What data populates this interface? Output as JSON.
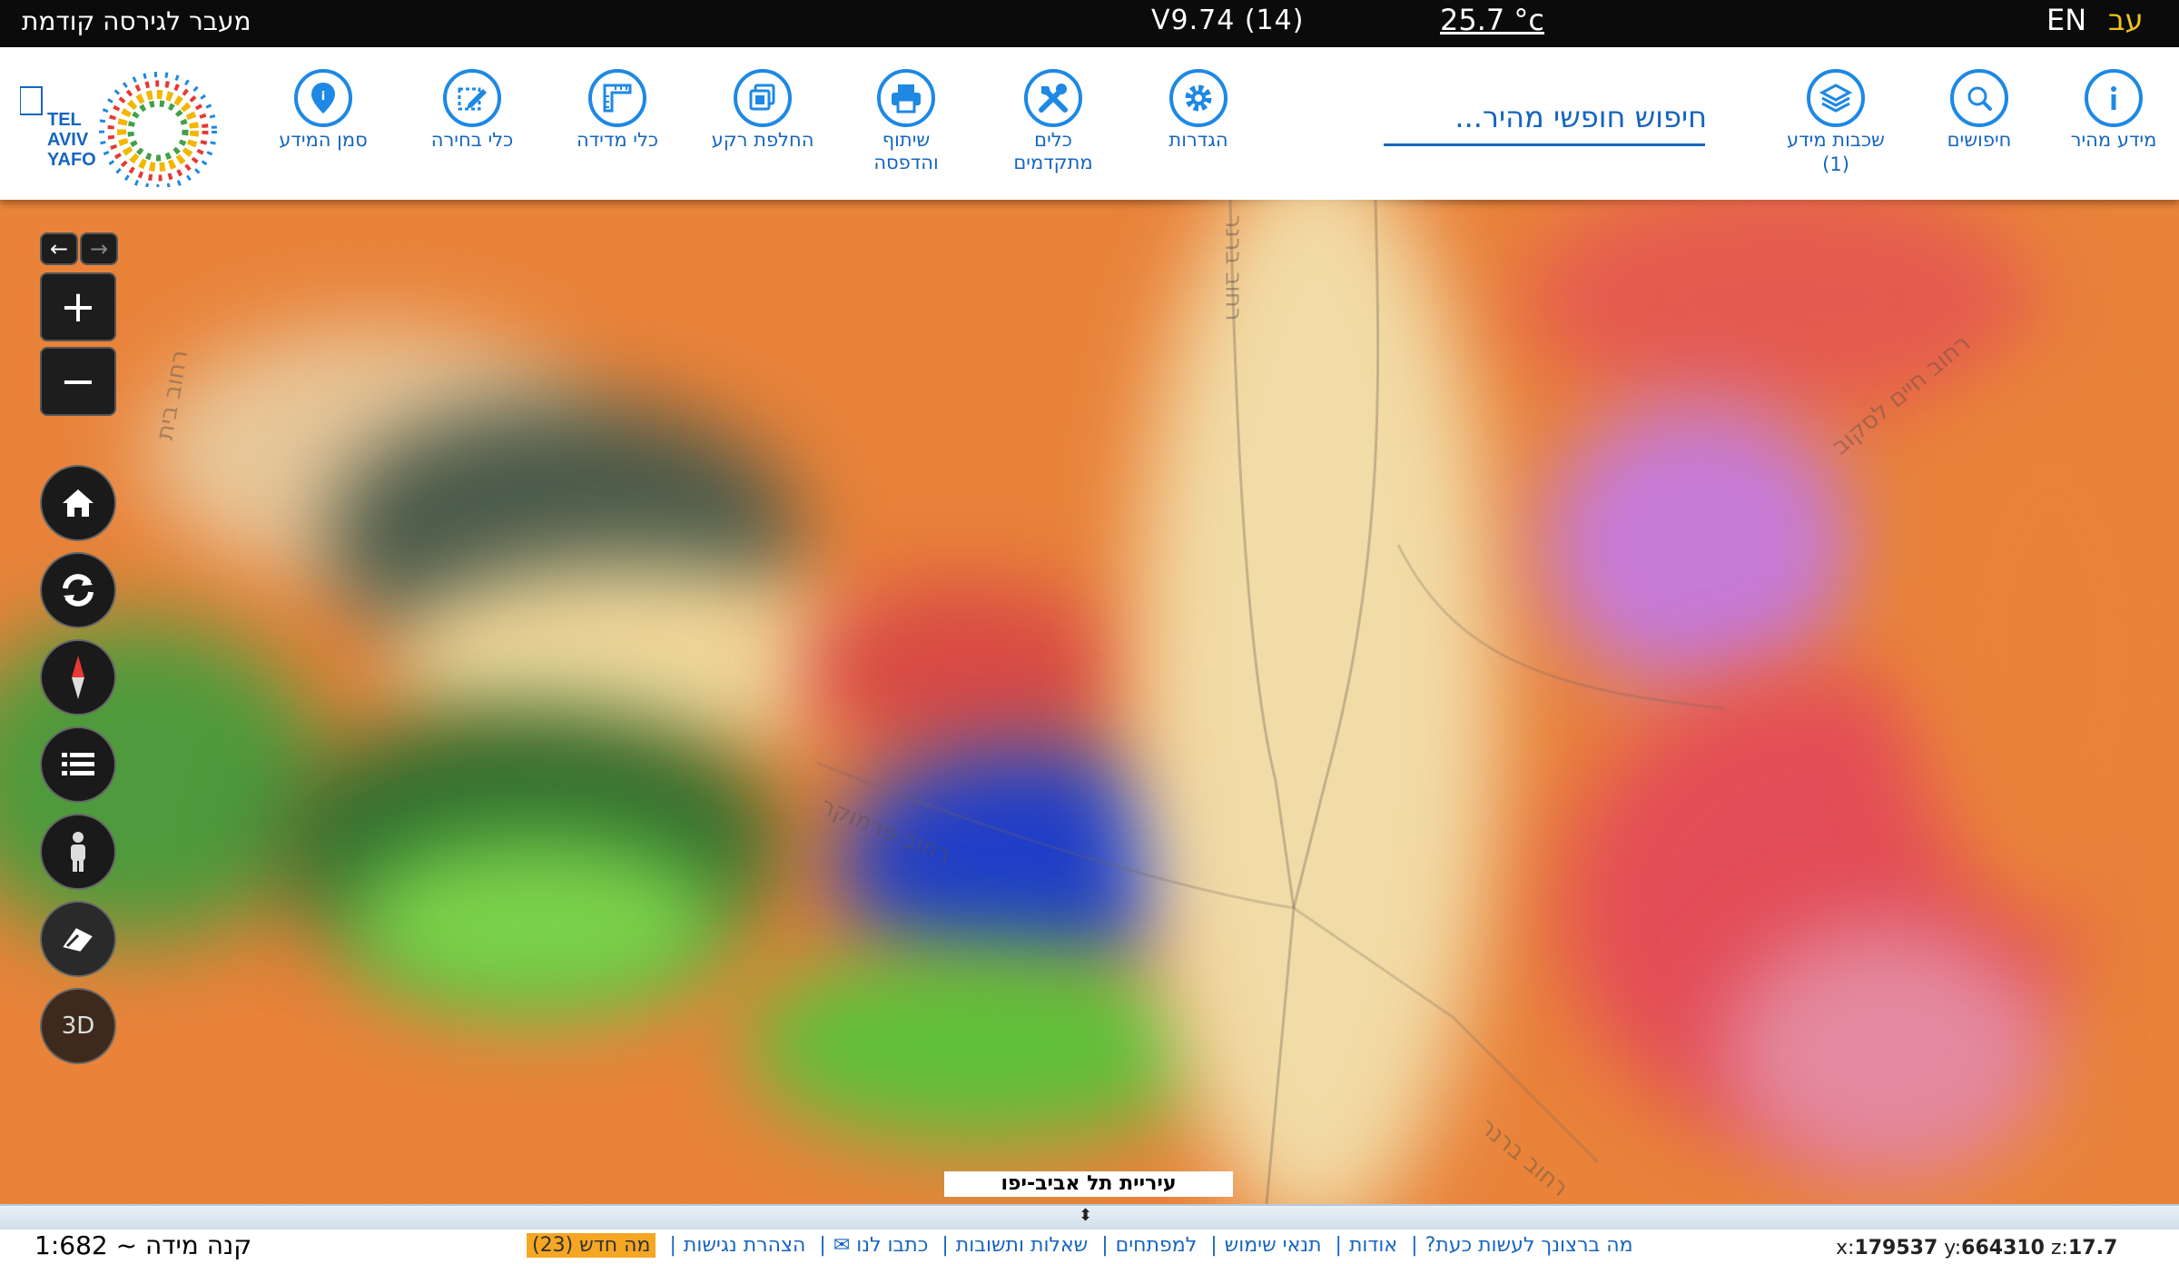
{
  "topbar": {
    "prev_version": "מעבר לגירסה קודמת",
    "version": "V9.74 (14)",
    "temperature": "25.7 °c",
    "lang_en": "EN",
    "lang_he": "עב"
  },
  "toolbar": {
    "quick_info": "מידע מהיר",
    "searches": "חיפושים",
    "layers": "שכבות מידע",
    "layers_count": "(1)",
    "search_placeholder": "חיפוש חופשי מהיר...",
    "settings": "הגדרות",
    "advanced_tools": "כלים מתקדמים",
    "share_print": "שיתוף והדפסה",
    "basemap": "החלפת רקע",
    "measure": "כלי מדידה",
    "select": "כלי בחירה",
    "marker": "סמן המידע",
    "logo_text": "TEL AVIV YAFO"
  },
  "map": {
    "municipality": "עיריית תל אביב-יפו",
    "street_labels": [
      "רחוב ברנר",
      "רחוב פרמוקר",
      "רחוב חיים לסקוב",
      "רחוב ברנר",
      "רחוב בית"
    ],
    "controls": {
      "zoom_in": "+",
      "zoom_out": "−",
      "threeD": "3D"
    }
  },
  "bottom": {
    "scale": "קנה מידה ~ 1:682",
    "links": [
      "מה ברצונך לעשות כעת?",
      "אודות",
      "תנאי שימוש",
      "למפתחים",
      "שאלות ותשובות",
      "כתבו לנו ✉",
      "הצהרת נגישות"
    ],
    "news": "מה חדש (23)",
    "coord_x_label": "x:",
    "coord_x": "179537",
    "coord_y_label": "y:",
    "coord_y": "664310",
    "coord_z_label": "z:",
    "coord_z": "17.7"
  },
  "colors": {
    "accent": "#1e88e5",
    "topbar": "#0b0b0b",
    "map_base": "#e9833a",
    "news_badge": "#f5a623"
  }
}
